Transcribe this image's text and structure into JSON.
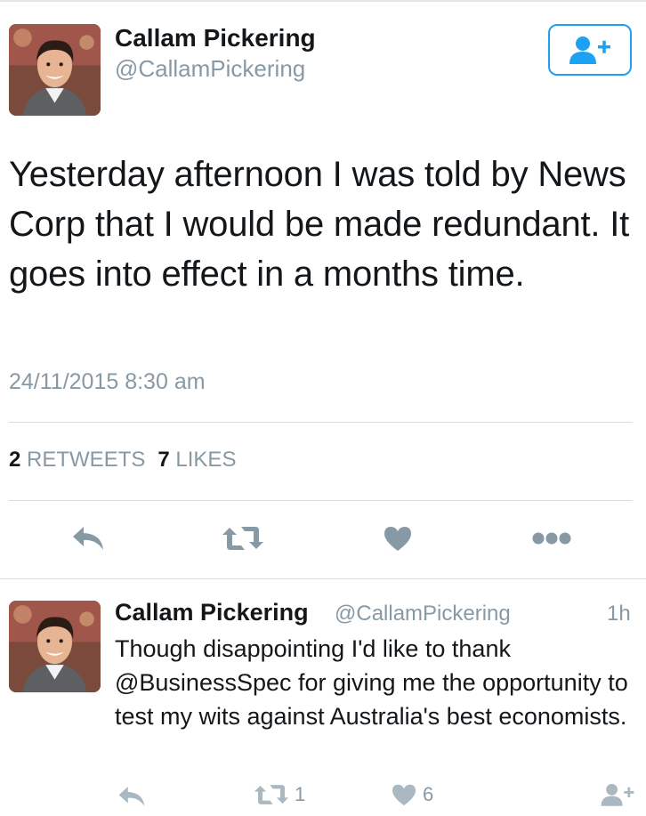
{
  "main_tweet": {
    "author": {
      "name": "Callam Pickering",
      "handle": "@CallamPickering"
    },
    "text": "Yesterday afternoon I was told by News Corp that I would be made redundant. It goes into effect in a months time.",
    "timestamp": "24/11/2015 8:30 am",
    "stats": {
      "retweets_count": "2",
      "retweets_label": "RETWEETS",
      "likes_count": "7",
      "likes_label": "LIKES"
    },
    "actions": [
      "reply-icon",
      "retweet-icon",
      "heart-icon",
      "more-icon"
    ],
    "follow_icon": "follow-user-icon"
  },
  "reply_tweet": {
    "author": {
      "name": "Callam Pickering",
      "handle": "@CallamPickering"
    },
    "time": "1h",
    "text": "Though disappointing I'd like to thank @BusinessSpec for giving me the opportunity to test my wits against Australia's best economists.",
    "retweet_count": "1",
    "like_count": "6"
  },
  "colors": {
    "accent": "#1da1f2",
    "muted": "#8899a6",
    "icon": "#aab8c2",
    "divider": "#d8dee2"
  }
}
